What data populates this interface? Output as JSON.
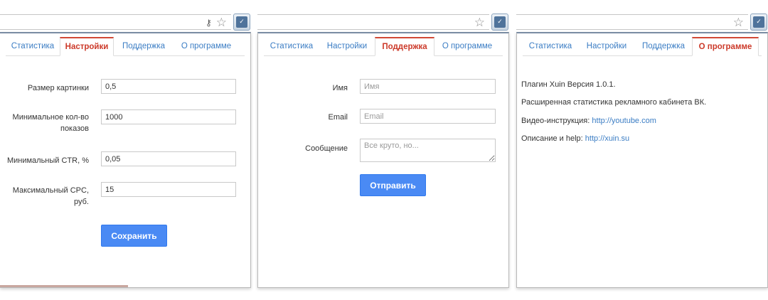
{
  "tabs": {
    "stats": "Статистика",
    "settings": "Настройки",
    "support": "Поддержка",
    "about": "О программе"
  },
  "settings": {
    "image_size_label": "Размер картинки",
    "image_size_value": "0,5",
    "min_impressions_label_line1": "Минимальное кол-во",
    "min_impressions_label_line2": "показов",
    "min_impressions_value": "1000",
    "min_ctr_label": "Минимальный CTR, %",
    "min_ctr_value": "0,05",
    "max_cpc_label_line1": "Максимальный CPC,",
    "max_cpc_label_line2": "руб.",
    "max_cpc_value": "15",
    "save_label": "Сохранить"
  },
  "support": {
    "name_label": "Имя",
    "name_placeholder": "Имя",
    "email_label": "Email",
    "email_placeholder": "Email",
    "message_label": "Сообщение",
    "message_placeholder": "Все круто, но...",
    "send_label": "Отправить"
  },
  "about": {
    "version": "Плагин Xuin Версия 1.0.1.",
    "description": "Расширенная статистика рекламного кабинета ВК.",
    "video_label": "Видео-инструкция:",
    "video_link": "http://youtube.com",
    "help_label": "Описание и help:",
    "help_link": "http://xuin.su"
  },
  "icons": {
    "star": "star-icon",
    "key": "key-icon",
    "extension": "extension-icon"
  },
  "colors": {
    "accent_blue": "#4a8af4",
    "active_tab": "#cc3a2a",
    "link": "#3b7dc4"
  }
}
